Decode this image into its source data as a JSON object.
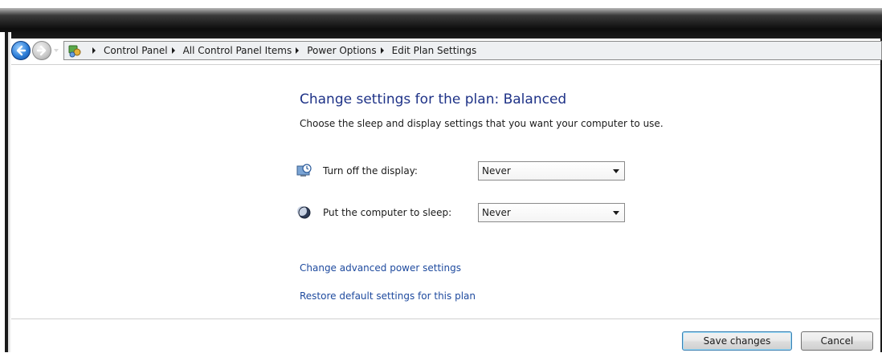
{
  "navigation": {
    "address_icon": "control-panel-icon",
    "breadcrumbs": [
      "Control Panel",
      "All Control Panel Items",
      "Power Options",
      "Edit Plan Settings"
    ]
  },
  "main": {
    "heading": "Change settings for the plan: Balanced",
    "subtext": "Choose the sleep and display settings that you want your computer to use.",
    "settings": [
      {
        "icon": "display-clock-icon",
        "label": "Turn off the display:",
        "value": "Never"
      },
      {
        "icon": "sleep-moon-icon",
        "label": "Put the computer to sleep:",
        "value": "Never"
      }
    ],
    "links": {
      "advanced": "Change advanced power settings",
      "restore": "Restore default settings for this plan"
    }
  },
  "footer": {
    "save_label": "Save changes",
    "cancel_label": "Cancel"
  },
  "colors": {
    "heading": "#1e3287",
    "link": "#1e4a9e"
  }
}
